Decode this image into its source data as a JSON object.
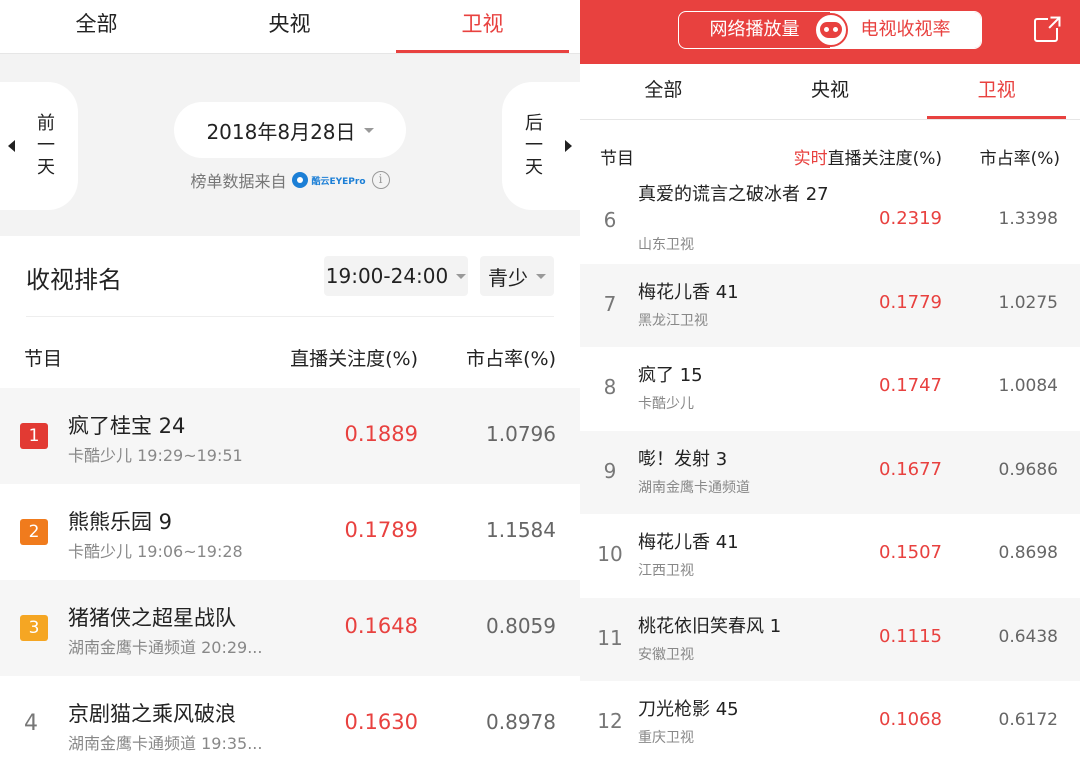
{
  "left": {
    "tabs": [
      {
        "label": "全部",
        "active": false
      },
      {
        "label": "央视",
        "active": false
      },
      {
        "label": "卫视",
        "active": true
      }
    ],
    "prev_day": "前一天",
    "next_day": "后一天",
    "date": "2018年8月28日",
    "source_label": "榜单数据来自",
    "source_logo_text": "酷云EYEPro",
    "ranking_title": "收视排名",
    "time_filter": "19:00-24:00",
    "group_filter": "青少",
    "columns": {
      "program": "节目",
      "attention": "直播关注度(%)",
      "share": "市占率(%)"
    },
    "rows": [
      {
        "rank": "1",
        "name": "疯了桂宝 24",
        "sub": "卡酷少儿 19:29~19:51",
        "attention": "0.1889",
        "share": "1.0796",
        "badge_color": "#e23a33"
      },
      {
        "rank": "2",
        "name": "熊熊乐园 9",
        "sub": "卡酷少儿 19:06~19:28",
        "attention": "0.1789",
        "share": "1.1584",
        "badge_color": "#f07b1d"
      },
      {
        "rank": "3",
        "name": "猪猪侠之超星战队",
        "sub": "湖南金鹰卡通频道 20:29...",
        "attention": "0.1648",
        "share": "0.8059",
        "badge_color": "#f5a623"
      },
      {
        "rank": "4",
        "name": "京剧猫之乘风破浪",
        "sub": "湖南金鹰卡通频道 19:35...",
        "attention": "0.1630",
        "share": "0.8978",
        "badge_color": ""
      }
    ]
  },
  "right": {
    "toggle": {
      "left": "网络播放量",
      "right": "电视收视率"
    },
    "tabs": [
      {
        "label": "全部",
        "active": false
      },
      {
        "label": "央视",
        "active": false
      },
      {
        "label": "卫视",
        "active": true
      }
    ],
    "columns": {
      "program": "节目",
      "realtime": "实时",
      "attention": "直播关注度(%)",
      "share": "市占率(%)"
    },
    "rows": [
      {
        "rank": "6",
        "name": "真爱的谎言之破冰者 27",
        "sub": "山东卫视",
        "attention": "0.2319",
        "share": "1.3398"
      },
      {
        "rank": "7",
        "name": "梅花儿香 41",
        "sub": "黑龙江卫视",
        "attention": "0.1779",
        "share": "1.0275"
      },
      {
        "rank": "8",
        "name": "疯了 15",
        "sub": "卡酷少儿",
        "attention": "0.1747",
        "share": "1.0084"
      },
      {
        "rank": "9",
        "name": "嘭！发射 3",
        "sub": "湖南金鹰卡通频道",
        "attention": "0.1677",
        "share": "0.9686"
      },
      {
        "rank": "10",
        "name": "梅花儿香 41",
        "sub": "江西卫视",
        "attention": "0.1507",
        "share": "0.8698"
      },
      {
        "rank": "11",
        "name": "桃花依旧笑春风 1",
        "sub": "安徽卫视",
        "attention": "0.1115",
        "share": "0.6438"
      },
      {
        "rank": "12",
        "name": "刀光枪影 45",
        "sub": "重庆卫视",
        "attention": "0.1068",
        "share": "0.6172"
      }
    ]
  }
}
